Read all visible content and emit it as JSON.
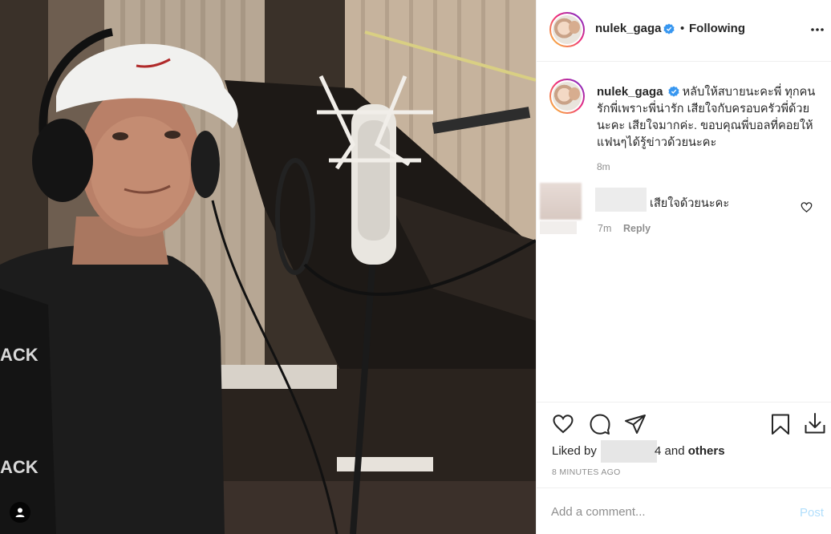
{
  "header": {
    "username": "nulek_gaga",
    "separator": "•",
    "follow_status": "Following",
    "verified_icon": "verified-badge-icon",
    "more_icon": "more-options-icon"
  },
  "caption": {
    "username": "nulek_gaga",
    "text": "หลับให้สบายนะคะพี่ ทุกคนรักพี่เพราะพี่น่ารัก เสียใจกับครอบครัวพี่ด้วยนะคะ เสียใจมากค่ะ. ขอบคุณพี่บอลที่คอยให้แฟนๆได้รู้ข่าวด้วยนะคะ",
    "time": "8m"
  },
  "comment": {
    "text": "เสียใจด้วยนะคะ",
    "time": "7m",
    "reply_label": "Reply",
    "heart_icon": "heart-outline-icon"
  },
  "actions": {
    "icons": [
      "heart-icon",
      "comment-icon",
      "share-icon",
      "save-icon",
      "download-icon"
    ],
    "liked_by_label": "Liked by",
    "liked_count_suffix": "4",
    "liked_tail": "and",
    "liked_others": "others",
    "post_time": "8 MINUTES AGO"
  },
  "add_comment": {
    "placeholder": "Add a comment...",
    "post_label": "Post"
  },
  "colors": {
    "verified_blue": "#3897f0",
    "post_button_disabled": "#b2dffc",
    "muted_text": "#8e8e8e"
  }
}
